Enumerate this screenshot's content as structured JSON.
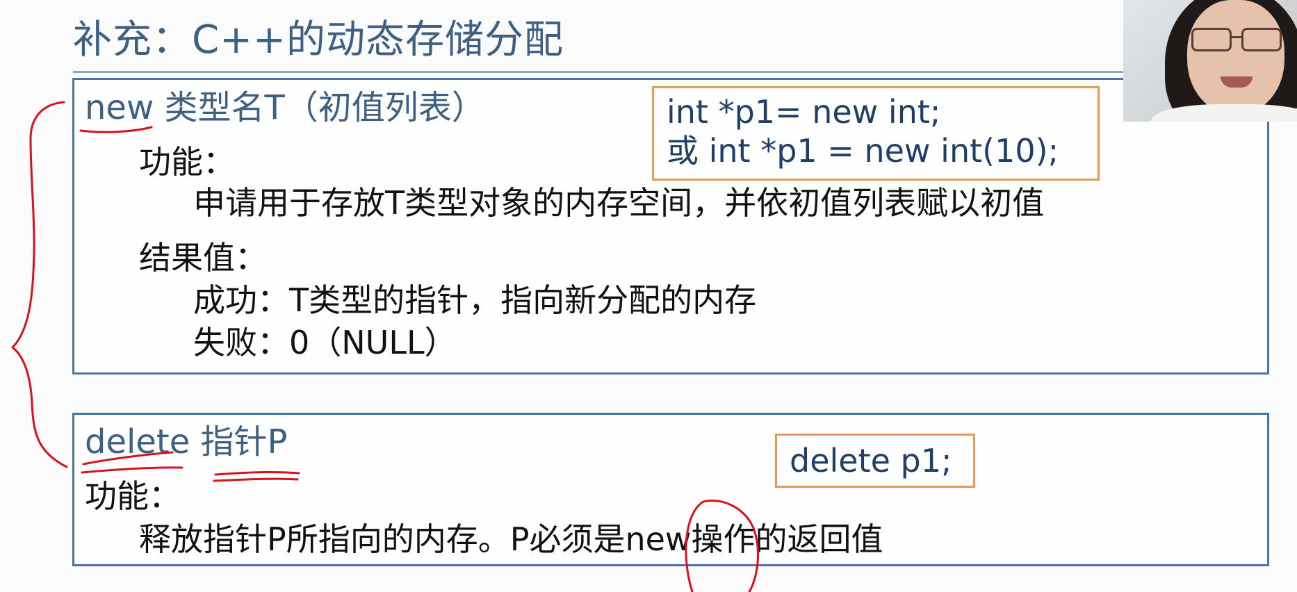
{
  "slide": {
    "title": "补充：C++的动态存储分配"
  },
  "new_section": {
    "heading": "new  类型名T（初值列表）",
    "function_label": "功能：",
    "function_desc": "申请用于存放T类型对象的内存空间，并依初值列表赋以初值",
    "result_label": "结果值：",
    "success": "成功：T类型的指针，指向新分配的内存",
    "failure": "失败：0（NULL）",
    "code_line1": "int *p1= new int;",
    "code_line2": "或 int *p1 = new int(10);"
  },
  "delete_section": {
    "heading": "delete 指针P",
    "function_label": "功能：",
    "function_desc": "释放指针P所指向的内存。P必须是new操作的返回值",
    "code_line1": "delete p1;"
  },
  "colors": {
    "title": "#3c5f82",
    "panel_border": "#4a74a6",
    "code_border": "#e59a55",
    "annotation_ink": "#d8121b"
  }
}
